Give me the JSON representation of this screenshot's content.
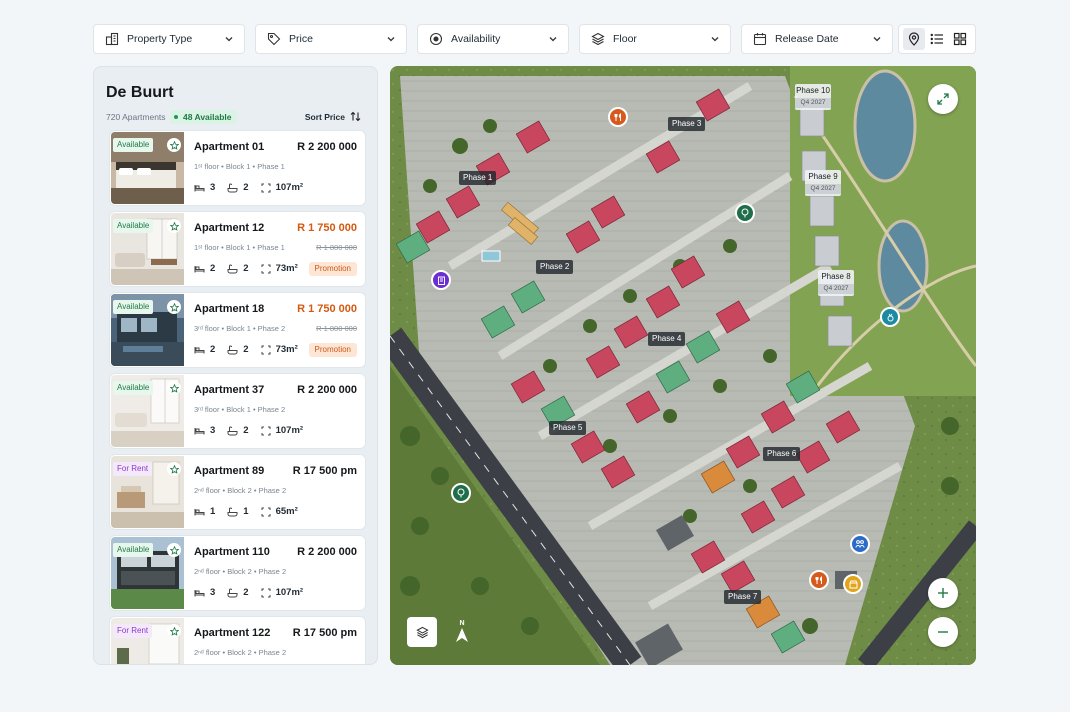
{
  "filters": [
    {
      "label": "Property Type",
      "icon": "building-icon"
    },
    {
      "label": "Price",
      "icon": "tag-icon"
    },
    {
      "label": "Availability",
      "icon": "radio-icon"
    },
    {
      "label": "Floor",
      "icon": "layers-icon"
    },
    {
      "label": "Release Date",
      "icon": "calendar-icon"
    }
  ],
  "view_modes": [
    "map-pin-icon",
    "list-icon",
    "grid-icon"
  ],
  "panel": {
    "title": "De Buurt",
    "count": "720 Apartments",
    "available": "48 Available",
    "sort": "Sort Price"
  },
  "listings": [
    {
      "status": "Available",
      "name": "Apartment 01",
      "price": "R 2 200 000",
      "old_price": "",
      "meta": "1ˢᵗ floor • Block 1 • Phase 1",
      "beds": "3",
      "baths": "2",
      "area": "107m²",
      "tag": ""
    },
    {
      "status": "Available",
      "name": "Apartment 12",
      "price": "R 1 750 000",
      "old_price": "R 1 800 000",
      "meta": "1ˢᵗ floor • Block 1 • Phase 1",
      "beds": "2",
      "baths": "2",
      "area": "73m²",
      "tag": "Promotion"
    },
    {
      "status": "Available",
      "name": "Apartment 18",
      "price": "R 1 750 000",
      "old_price": "R 1 800 000",
      "meta": "3ʳᵈ floor • Block 1 • Phase 2",
      "beds": "2",
      "baths": "2",
      "area": "73m²",
      "tag": "Promotion"
    },
    {
      "status": "Available",
      "name": "Apartment 37",
      "price": "R 2 200 000",
      "old_price": "",
      "meta": "3ʳᵈ floor • Block 1 • Phase 2",
      "beds": "3",
      "baths": "2",
      "area": "107m²",
      "tag": ""
    },
    {
      "status": "For Rent",
      "name": "Apartment 89",
      "price": "R 17 500 pm",
      "old_price": "",
      "meta": "2ⁿᵈ floor • Block 2 • Phase 2",
      "beds": "1",
      "baths": "1",
      "area": "65m²",
      "tag": ""
    },
    {
      "status": "Available",
      "name": "Apartment 110",
      "price": "R 2 200 000",
      "old_price": "",
      "meta": "2ⁿᵈ floor • Block 2 • Phase 2",
      "beds": "3",
      "baths": "2",
      "area": "107m²",
      "tag": ""
    },
    {
      "status": "For Rent",
      "name": "Apartment 122",
      "price": "R 17 500 pm",
      "old_price": "",
      "meta": "2ⁿᵈ floor • Block 2 • Phase 2",
      "beds": "",
      "baths": "",
      "area": "",
      "tag": ""
    }
  ],
  "map": {
    "phases": [
      "Phase 1",
      "Phase 2",
      "Phase 3",
      "Phase 4",
      "Phase 5",
      "Phase 6",
      "Phase 7"
    ],
    "future_phases": [
      {
        "name": "Phase 10",
        "date": "Q4 2027"
      },
      {
        "name": "Phase 9",
        "date": "Q4 2027"
      },
      {
        "name": "Phase 8",
        "date": "Q4 2027"
      }
    ],
    "compass": "N",
    "colors": {
      "available": "#c8475e",
      "sold": "#5fae7f",
      "reserved": "#d98a3a",
      "future": "#c9ccd0"
    }
  }
}
